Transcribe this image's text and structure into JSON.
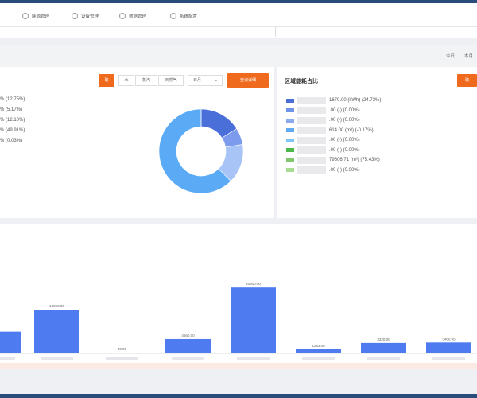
{
  "nav": {
    "items": [
      {
        "label": "能源管理"
      },
      {
        "label": "设备管理"
      },
      {
        "label": "数据管理"
      },
      {
        "label": "系统配置"
      }
    ]
  },
  "toolbar": {
    "today": "今日",
    "month": "本月"
  },
  "left_panel": {
    "confirm_button": "确",
    "tabs": [
      "水",
      "蒸汽",
      "天然气"
    ],
    "select_value": "日月",
    "action_button": "查询详细",
    "legend_lines": [
      "% (12.75%)",
      "% (5.17%)",
      "% (12.10%)",
      "% (49.91%)",
      "% (0.03%)"
    ]
  },
  "right_panel": {
    "title": "区域能耗占比",
    "button": "确",
    "legend": [
      {
        "text": "1670.00 (kWh) (24.73%)",
        "color": "#4a6fd8"
      },
      {
        "text": ".00 (-) (0.00%)",
        "color": "#6f93e8"
      },
      {
        "text": ".00 (-) (0.00%)",
        "color": "#8aaaf0"
      },
      {
        "text": "614.00 (m³) (-0.17%)",
        "color": "#5faaf0"
      },
      {
        "text": ".00 (-) (0.00%)",
        "color": "#7ec4f4"
      },
      {
        "text": ".00 (-) (0.00%)",
        "color": "#4cb848"
      },
      {
        "text": "79606.71 (m³) (75.43%)",
        "color": "#7cc86a"
      },
      {
        "text": ".00 (-) (0.00%)",
        "color": "#a8dc8e"
      }
    ]
  },
  "donut_data": {
    "slices": [
      {
        "value": 12.75,
        "color": "#4a6fd8"
      },
      {
        "value": 5.17,
        "color": "#7c9bec"
      },
      {
        "value": 12.1,
        "color": "#a8c3f6"
      },
      {
        "value": 49.91,
        "color": "#5aaaf6"
      },
      {
        "value": 0.03,
        "color": "#6fb6f2"
      }
    ]
  },
  "chart_data": {
    "type": "bar",
    "categories": [
      "",
      "",
      "",
      "",
      "",
      "",
      "",
      ""
    ],
    "values": [
      6920,
      13850.8,
      30,
      4560,
      20940,
      1283,
      3320,
      3460.95
    ],
    "labels": [
      "",
      "13850.80",
      "30.00",
      "4560.00",
      "20940.00",
      "1283.00",
      "3320.00",
      "3460.95"
    ],
    "color": "#4f7bf0"
  }
}
